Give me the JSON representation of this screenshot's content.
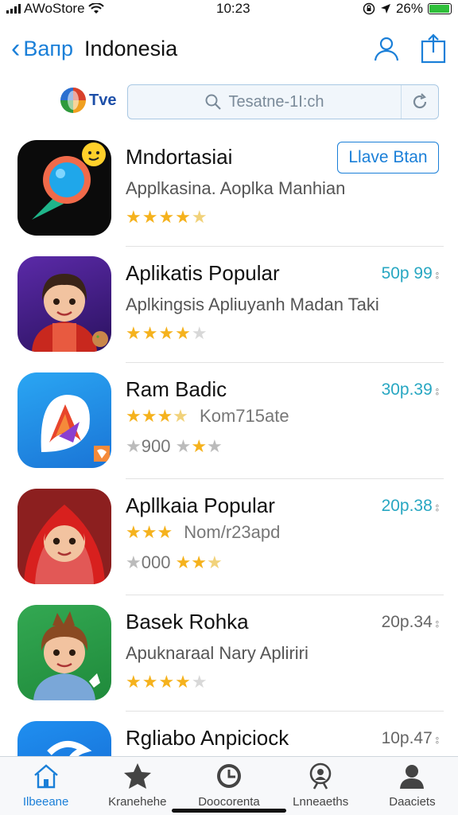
{
  "status_bar": {
    "carrier": "AWoStore",
    "time": "10:23",
    "battery_percent": "26%",
    "battery_level": 0.95,
    "icons": [
      "signal-icon",
      "wifi-icon",
      "lock-rotation-icon",
      "location-icon",
      "battery-icon"
    ]
  },
  "nav": {
    "back_label": "Bапр",
    "title": "Indonesia",
    "icons": [
      "back-chevron-icon",
      "profile-icon",
      "share-icon"
    ],
    "accent_color": "#1a7fd8"
  },
  "search": {
    "brand": "Tve",
    "placeholder": "Tesatne-1I:ch",
    "icons": [
      "search-icon",
      "refresh-icon"
    ]
  },
  "apps": [
    {
      "name": "Mndortasiai",
      "subtitle": "Applkasina. Aoplka Manhian",
      "rating_stars": 4.5,
      "button": "Llave Btan",
      "icon": "magnifier-app-icon"
    },
    {
      "name": "Aplikatis Popular",
      "subtitle": "Aplkingsis Apliuyanh Madan Taki",
      "rating_stars": 4,
      "price": "50p 99",
      "icon": "girl-character-app-icon"
    },
    {
      "name": "Ram Badic",
      "rating_stars": 3.5,
      "rating_text": "Kom715ate",
      "review_count": "900",
      "secondary_stars": 1.5,
      "price": "30p.39",
      "icon": "play-logo-app-icon"
    },
    {
      "name": "Apllkaia Popular",
      "rating_stars": 3,
      "rating_text": "Nom/r23apd",
      "review_count": "000",
      "secondary_stars": 2.5,
      "price": "20p.38",
      "icon": "hijab-character-app-icon"
    },
    {
      "name": "Basek Rohka",
      "subtitle": "Apuknaraal Nary Apliriri",
      "rating_stars": 4,
      "price": "20p.34",
      "icon": "boy-character-app-icon"
    },
    {
      "name": "Rgliabo Anpiciock",
      "price": "10p.47",
      "icon": "blue-app-icon"
    }
  ],
  "tabs": [
    {
      "label": "Ilbeeane",
      "icon": "home-icon",
      "active": true
    },
    {
      "label": "Kranehehe",
      "icon": "star-icon",
      "active": false
    },
    {
      "label": "Doocorenta",
      "icon": "clock-icon",
      "active": false
    },
    {
      "label": "Lnneaeths",
      "icon": "search-person-icon",
      "active": false
    },
    {
      "label": "Daaciets",
      "icon": "person-icon",
      "active": false
    }
  ],
  "colors": {
    "accent": "#1a7fd8",
    "price": "#28a7c2",
    "star": "#f5b21d",
    "battery": "#2fbf3a"
  }
}
